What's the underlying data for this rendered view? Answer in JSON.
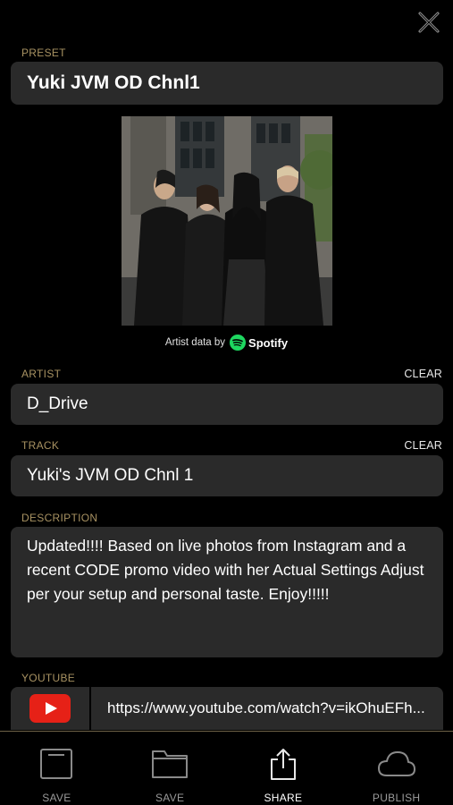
{
  "preset": {
    "label": "PRESET",
    "value": "Yuki JVM OD Chnl1"
  },
  "spotify": {
    "attribution": "Artist data by",
    "brand": "Spotify"
  },
  "artist": {
    "label": "ARTIST",
    "value": "D_Drive",
    "clear": "CLEAR"
  },
  "track": {
    "label": "TRACK",
    "value": "Yuki's JVM OD Chnl 1",
    "clear": "CLEAR"
  },
  "description": {
    "label": "DESCRIPTION",
    "value": "Updated!!!! Based on live photos from Instagram and a recent CODE promo video with her Actual Settings Adjust per your setup and personal taste.  Enjoy!!!!!"
  },
  "youtube": {
    "label": "YOUTUBE",
    "url": "https://www.youtube.com/watch?v=ikOhuEFh..."
  },
  "toolbar": {
    "items": [
      {
        "label": "SAVE",
        "icon": "save-square-icon"
      },
      {
        "label": "SAVE",
        "icon": "folder-icon"
      },
      {
        "label": "SHARE",
        "icon": "share-icon"
      },
      {
        "label": "PUBLISH",
        "icon": "cloud-icon"
      }
    ]
  },
  "colors": {
    "accent": "#a89262",
    "field_bg": "#2a2a2a",
    "youtube_red": "#e62117",
    "spotify_green": "#1ed760"
  }
}
